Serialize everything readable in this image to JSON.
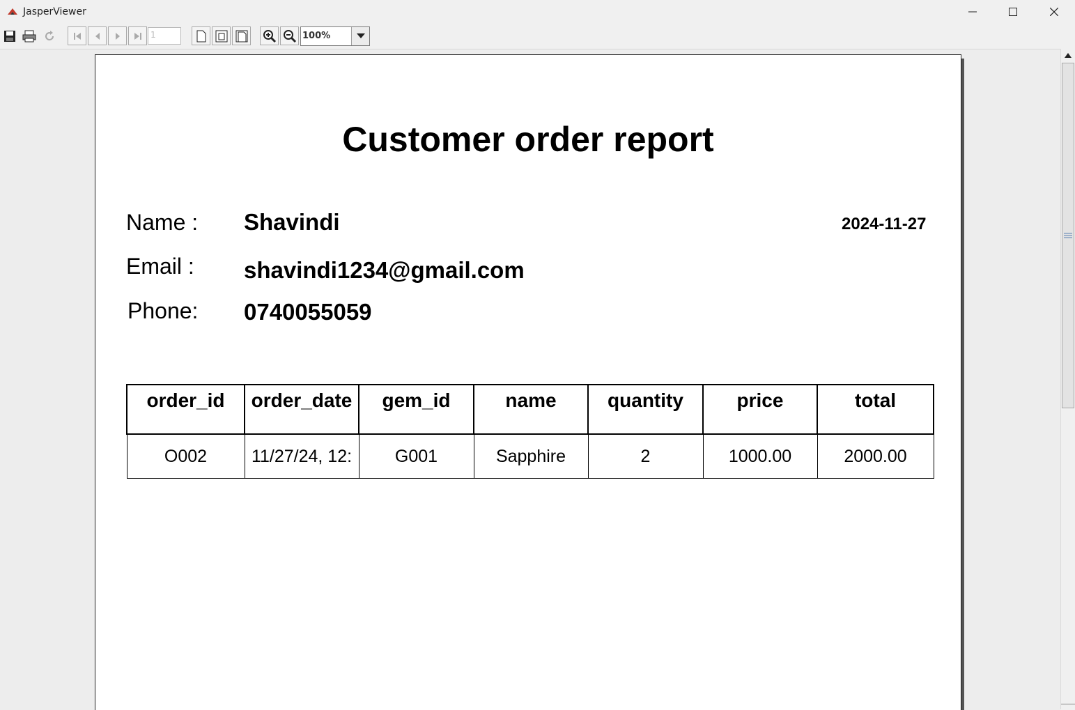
{
  "window": {
    "title": "JasperViewer"
  },
  "toolbar": {
    "page_number": "1",
    "zoom": "100%",
    "buttons": [
      "save-icon",
      "print-icon",
      "reload-icon",
      "first-page-icon",
      "previous-page-icon",
      "next-page-icon",
      "last-page-icon",
      "actual-size-icon",
      "fit-page-icon",
      "fit-width-icon",
      "zoom-in-icon",
      "zoom-out-icon"
    ]
  },
  "report": {
    "title": "Customer order report",
    "name_label": "Name :",
    "name_value": "Shavindi",
    "email_label": "Email :",
    "email_value": "shavindi1234@gmail.com",
    "phone_label": "Phone:",
    "phone_value": "0740055059",
    "date": "2024-11-27",
    "columns": [
      "order_id",
      "order_date",
      "gem_id",
      "name",
      "quantity",
      "price",
      "total"
    ],
    "rows": [
      [
        "O002",
        "11/27/24, 12:",
        "G001",
        "Sapphire",
        "2",
        "1000.00",
        "2000.00"
      ]
    ]
  },
  "colors": {
    "app_icon": "#c0392b",
    "page_border": "#222222",
    "background": "#ededed"
  }
}
